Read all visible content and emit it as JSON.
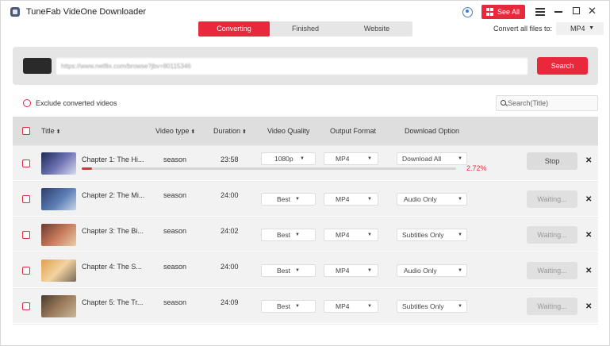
{
  "app": {
    "title": "TuneFab VideOne Downloader"
  },
  "tabs": [
    {
      "label": "Converting",
      "active": true
    },
    {
      "label": "Finished",
      "active": false
    },
    {
      "label": "Website",
      "active": false
    }
  ],
  "header": {
    "see_all_label": "See All",
    "convert_all_label": "Convert all files to:",
    "convert_all_value": "MP4",
    "accent_color": "#e8293c"
  },
  "url_bar": {
    "value": "https://www.netflix.com/browse?jbv=80115346",
    "search_label": "Search"
  },
  "options": {
    "exclude_label": "Exclude converted videos",
    "search_placeholder": "Search(Title)"
  },
  "table": {
    "columns": {
      "title": "Title",
      "video_type": "Video type",
      "duration": "Duration",
      "video_quality": "Video Quality",
      "output_format": "Output Format",
      "download_option": "Download Option"
    },
    "rows": [
      {
        "title": "Chapter 1: The Hi...",
        "type": "season",
        "duration": "23:58",
        "quality": "1080p",
        "format": "MP4",
        "option": "Download All",
        "action": "Stop",
        "progress": 0.0272,
        "progress_label": "2.72%"
      },
      {
        "title": "Chapter 2: The Mi...",
        "type": "season",
        "duration": "24:00",
        "quality": "Best",
        "format": "MP4",
        "option": "Audio Only",
        "action": "Waiting..."
      },
      {
        "title": "Chapter 3: The Bi...",
        "type": "season",
        "duration": "24:02",
        "quality": "Best",
        "format": "MP4",
        "option": "Subtitles Only",
        "action": "Waiting..."
      },
      {
        "title": "Chapter 4: The S...",
        "type": "season",
        "duration": "24:00",
        "quality": "Best",
        "format": "MP4",
        "option": "Audio Only",
        "action": "Waiting..."
      },
      {
        "title": "Chapter 5: The Tr...",
        "type": "season",
        "duration": "24:09",
        "quality": "Best",
        "format": "MP4",
        "option": "Subtitles Only",
        "action": "Waiting..."
      }
    ]
  }
}
